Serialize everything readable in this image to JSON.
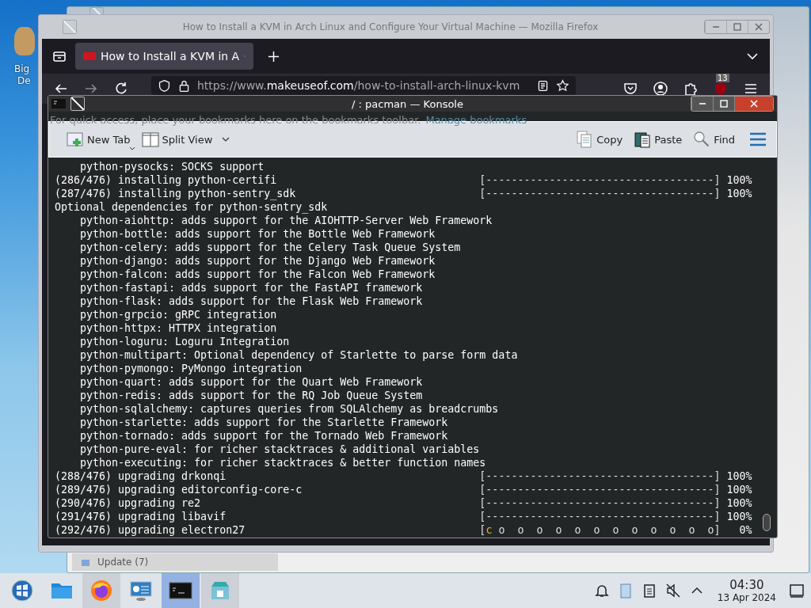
{
  "desktop_icon": {
    "label_lines": [
      "Big",
      "De"
    ]
  },
  "back_window": {
    "task_label": "Update (7)"
  },
  "firefox": {
    "title": "How to Install a KVM in Arch Linux and Configure Your Virtual Machine — Mozilla Firefox",
    "tabs": [
      {
        "label": "How to Install a KVM in A",
        "selected": true
      }
    ],
    "url": {
      "prefix": "https://www.",
      "domain": "makeuseof.com",
      "path": "/how-to-install-arch-linux-kvm"
    },
    "extension_badge": "13",
    "bookmarks_hint": "For quick access, place your bookmarks here on the bookmarks toolbar.",
    "bookmarks_link": "Manage bookmarks"
  },
  "konsole": {
    "title": "/ : pacman — Konsole",
    "toolbar_left": [
      {
        "kind": "new-tab",
        "label": "New Tab"
      },
      {
        "kind": "split-view",
        "label": "Split View"
      }
    ],
    "toolbar_right": [
      {
        "kind": "copy",
        "label": "Copy"
      },
      {
        "kind": "paste",
        "label": "Paste"
      },
      {
        "kind": "find",
        "label": "Find"
      }
    ],
    "lines": [
      {
        "kind": "group",
        "children": [
          {
            "text": "python-pysocks: SOCKS support"
          }
        ]
      },
      {
        "kind": "progress",
        "label": "(286/476) installing python-certifi",
        "bar": "[------------------------------------]",
        "percent": "100%"
      },
      {
        "kind": "progress",
        "label": "(287/476) installing python-sentry_sdk",
        "bar": "[------------------------------------]",
        "percent": "100%"
      },
      {
        "kind": "text",
        "text": "Optional dependencies for python-sentry_sdk",
        "children": [
          {
            "text": "python-aiohttp: adds support for the AIOHTTP-Server Web Framework"
          },
          {
            "text": "python-bottle: adds support for the Bottle Web Framework"
          },
          {
            "text": "python-celery: adds support for the Celery Task Queue System"
          },
          {
            "text": "python-django: adds support for the Django Web Framework"
          },
          {
            "text": "python-falcon: adds support for the Falcon Web Framework"
          },
          {
            "text": "python-fastapi: adds support for the FastAPI framework"
          },
          {
            "text": "python-flask: adds support for the Flask Web Framework"
          },
          {
            "text": "python-grpcio: gRPC integration"
          },
          {
            "text": "python-httpx: HTTPX integration"
          },
          {
            "text": "python-loguru: Loguru Integration"
          },
          {
            "text": "python-multipart: Optional dependency of Starlette to parse form data"
          },
          {
            "text": "python-pymongo: PyMongo integration"
          },
          {
            "text": "python-quart: adds support for the Quart Web Framework"
          },
          {
            "text": "python-redis: adds support for the RQ Job Queue System"
          },
          {
            "text": "python-sqlalchemy: captures queries from SQLAlchemy as breadcrumbs"
          },
          {
            "text": "python-starlette: adds support for the Starlette Framework"
          },
          {
            "text": "python-tornado: adds support for the Tornado Web Framework"
          },
          {
            "text": "python-pure-eval: for richer stacktraces & additional variables"
          },
          {
            "text": "python-executing: for richer stacktraces & better function names"
          }
        ]
      },
      {
        "kind": "progress",
        "label": "(288/476) upgrading drkonqi",
        "bar": "[------------------------------------]",
        "percent": "100%"
      },
      {
        "kind": "progress",
        "label": "(289/476) upgrading editorconfig-core-c",
        "bar": "[------------------------------------]",
        "percent": "100%"
      },
      {
        "kind": "progress",
        "label": "(290/476) upgrading re2",
        "bar": "[------------------------------------]",
        "percent": "100%"
      },
      {
        "kind": "progress",
        "label": "(291/476) upgrading libavif",
        "bar": "[------------------------------------]",
        "percent": "100%"
      },
      {
        "kind": "pacman",
        "label": "(292/476) upgrading electron27",
        "open": "[",
        "pacman": "c",
        "bar": " o  o  o  o  o  o  o  o  o  o  o  o]",
        "percent": "0%"
      }
    ]
  },
  "taskbar": {
    "apps": [
      {
        "kind": "start",
        "running": false,
        "selected": false
      },
      {
        "kind": "files",
        "running": false,
        "selected": false
      },
      {
        "kind": "firefox",
        "running": true,
        "selected": false
      },
      {
        "kind": "settings",
        "running": false,
        "selected": false
      },
      {
        "kind": "terminal",
        "running": true,
        "selected": true
      },
      {
        "kind": "store",
        "running": true,
        "selected": false
      }
    ],
    "time": "04:30",
    "date": "13 Apr 2024"
  }
}
